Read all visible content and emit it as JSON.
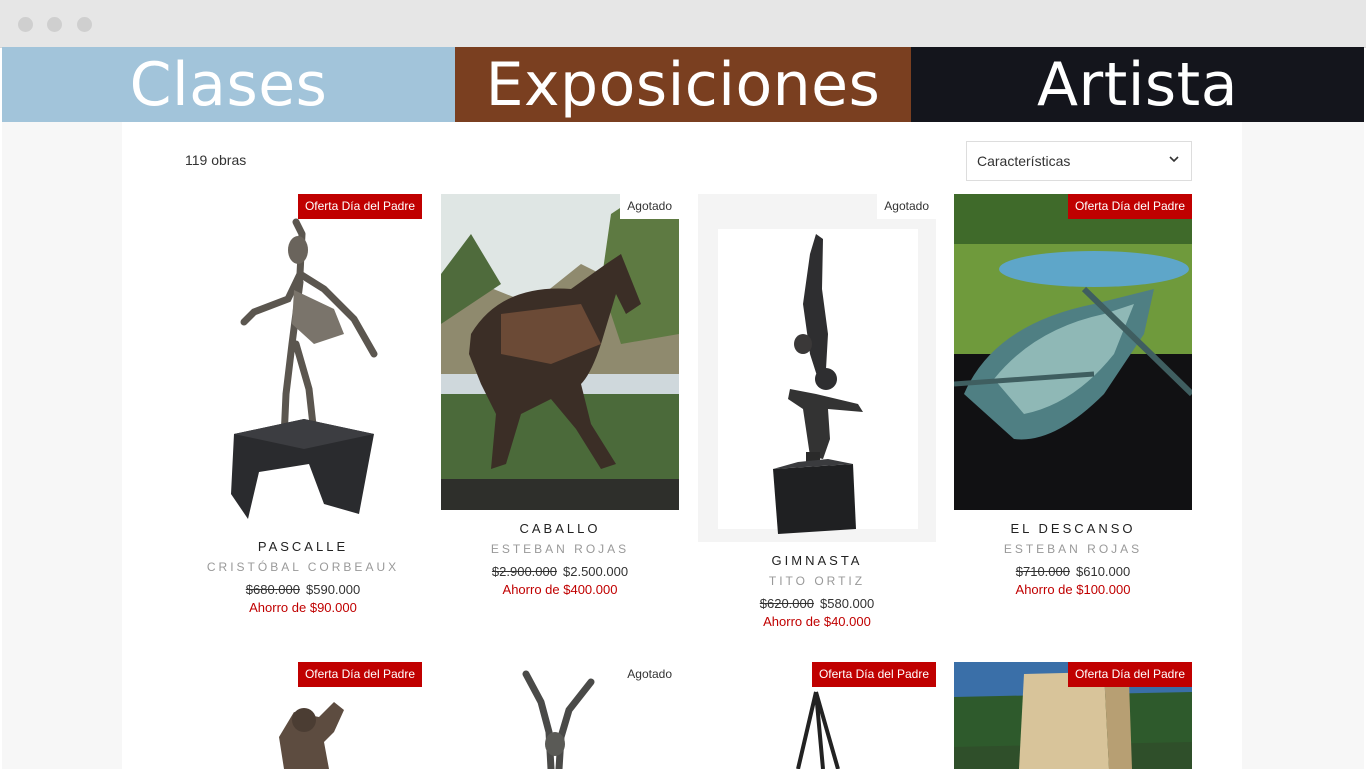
{
  "nav": {
    "items": [
      {
        "label": "Clases",
        "color": "#a2c4da"
      },
      {
        "label": "Exposiciones",
        "color": "#7a3f20"
      },
      {
        "label": "Artista",
        "color": "#14151c"
      }
    ]
  },
  "catalog": {
    "count_label": "119 obras",
    "sort_selected": "Características"
  },
  "products": [
    {
      "badge": "Oferta Día del Padre",
      "badge_type": "sale",
      "title": "PASCALLE",
      "artist": "CRISTÓBAL CORBEAUX",
      "old_price": "$680.000",
      "price": "$590.000",
      "saving": "Ahorro de $90.000"
    },
    {
      "badge": "Agotado",
      "badge_type": "soldout",
      "title": "CABALLO",
      "artist": "ESTEBAN ROJAS",
      "old_price": "$2.900.000",
      "price": "$2.500.000",
      "saving": "Ahorro de $400.000"
    },
    {
      "badge": "Agotado",
      "badge_type": "soldout",
      "title": "GIMNASTA",
      "artist": "TITO ORTIZ",
      "old_price": "$620.000",
      "price": "$580.000",
      "saving": "Ahorro de $40.000"
    },
    {
      "badge": "Oferta Día del Padre",
      "badge_type": "sale",
      "title": "EL DESCANSO",
      "artist": "ESTEBAN ROJAS",
      "old_price": "$710.000",
      "price": "$610.000",
      "saving": "Ahorro de $100.000"
    },
    {
      "badge": "Oferta Día del Padre",
      "badge_type": "sale"
    },
    {
      "badge": "Agotado",
      "badge_type": "soldout"
    },
    {
      "badge": "Oferta Día del Padre",
      "badge_type": "sale"
    },
    {
      "badge": "Oferta Día del Padre",
      "badge_type": "sale"
    }
  ],
  "colors": {
    "sale_badge": "#c00000",
    "saving_text": "#c00000",
    "page_bg": "#f7f7f7"
  }
}
